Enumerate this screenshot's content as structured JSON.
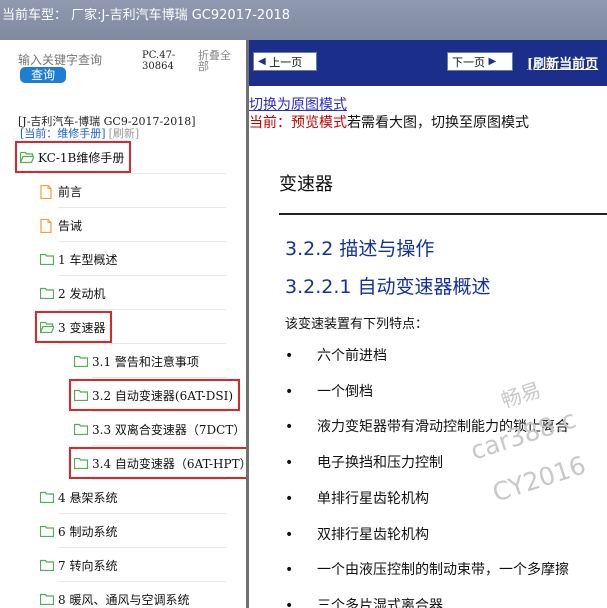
{
  "title": {
    "label": "当前车型：",
    "value": "厂家:J-吉利汽车博瑞 GC92017-2018"
  },
  "sidebar": {
    "search_placeholder": "输入关键字查询",
    "search_button": "查询",
    "pc_code": "PC.47-30864",
    "collapse_all": "折叠全部",
    "vehicle": "[J-吉利汽车-博瑞 GC9-2017-2018]",
    "current_label": "[当前：维修手册]",
    "refresh_label": "[刷新]",
    "tree": [
      {
        "label": "KC-1B维修手册",
        "icon": "folder-open-icon",
        "level": 0
      },
      {
        "label": "前言",
        "icon": "document-icon",
        "level": 1
      },
      {
        "label": "告诫",
        "icon": "document-icon",
        "level": 1
      },
      {
        "label": "1 车型概述",
        "icon": "folder-icon",
        "level": 1
      },
      {
        "label": "2 发动机",
        "icon": "folder-icon",
        "level": 1
      },
      {
        "label": "3 变速器",
        "icon": "folder-open-icon",
        "level": 1
      },
      {
        "label": "3.1 警告和注意事项",
        "icon": "folder-icon",
        "level": 2
      },
      {
        "label": "3.2 自动变速器(6AT-DSI)",
        "icon": "folder-icon",
        "level": 2
      },
      {
        "label": "3.3 双离合变速器（7DCT）",
        "icon": "folder-icon",
        "level": 2
      },
      {
        "label": "3.4 自动变速器（6AT-HPT）",
        "icon": "folder-icon",
        "level": 2
      },
      {
        "label": "4 悬架系统",
        "icon": "folder-icon",
        "level": 1
      },
      {
        "label": "6 制动系统",
        "icon": "folder-icon",
        "level": 1
      },
      {
        "label": "7 转向系统",
        "icon": "folder-icon",
        "level": 1
      },
      {
        "label": "8 暖风、通风与空调系统",
        "icon": "folder-icon",
        "level": 1
      }
    ]
  },
  "content": {
    "prev_button": "上一页",
    "next_button": "下一页",
    "refresh_link": "[刷新当前页",
    "switch_link": "切换为原图模式",
    "preview_label": "当前：预览模式",
    "preview_hint": "若需看大图，切换至原图模式",
    "section_title": "变速器",
    "heading1": "3.2.2 描述与操作",
    "heading2": "3.2.2.1  自动变速器概述",
    "intro": "该变速装置有下列特点：",
    "bullets": [
      "六个前进档",
      "一个倒档",
      "液力变矩器带有滑动控制能力的锁止离合",
      "电子换挡和压力控制",
      "单排行星齿轮机构",
      "双排行星齿轮机构",
      "一个由液压控制的制动束带，一个多摩擦",
      "三个多片湿式离合器"
    ],
    "bullet_char": "•",
    "watermark": [
      "畅易",
      "car388.c",
      "CY2016"
    ]
  },
  "colors": {
    "highlight": "#e0252a",
    "folder": "#4caf50",
    "doc": "#f0a030",
    "navbar": "#1b2f8a",
    "link": "#2a2ad0"
  }
}
